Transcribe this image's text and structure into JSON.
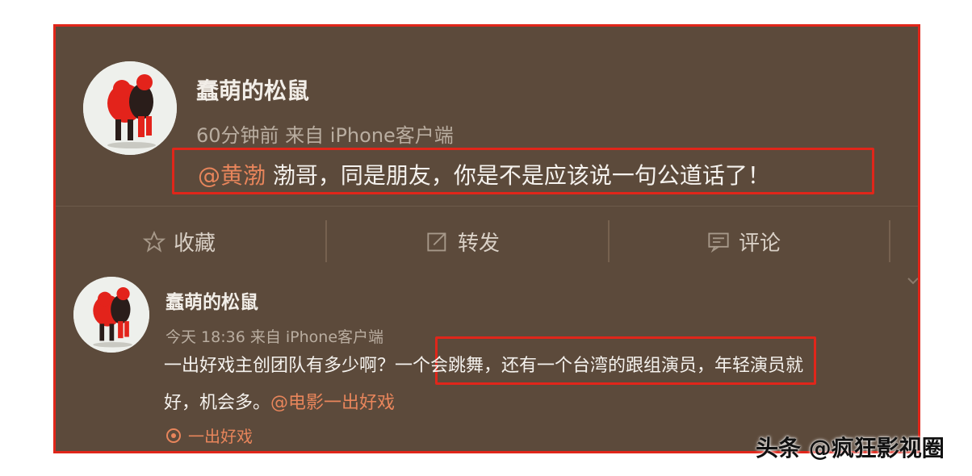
{
  "post": {
    "author": "蠢萌的松鼠",
    "meta": "60分钟前 来自 iPhone客户端",
    "mention": "@黄渤",
    "content": " 渤哥，同是朋友，你是不是应该说一句公道话了！"
  },
  "actions": [
    {
      "icon": "star-icon",
      "label": "收藏"
    },
    {
      "icon": "repost-icon",
      "label": "转发"
    },
    {
      "icon": "comment-icon",
      "label": "评论"
    }
  ],
  "reply": {
    "author": "蠢萌的松鼠",
    "meta": "今天 18:36 来自 iPhone客户端",
    "line1_a": "一出好戏主创团队有多少啊？",
    "line1_b": "一个会跳舞，还有一个台湾的跟组演员",
    "line1_c": "，年轻演员就",
    "line2_a": "好，机会多。",
    "line2_mention": "@电影一出好戏",
    "topic_label": "一出好戏"
  },
  "watermark": "头条 @疯狂影视圈",
  "colors": {
    "background": "#5c4a3b",
    "highlight_border": "#e0261a",
    "mention": "#e8855b"
  }
}
